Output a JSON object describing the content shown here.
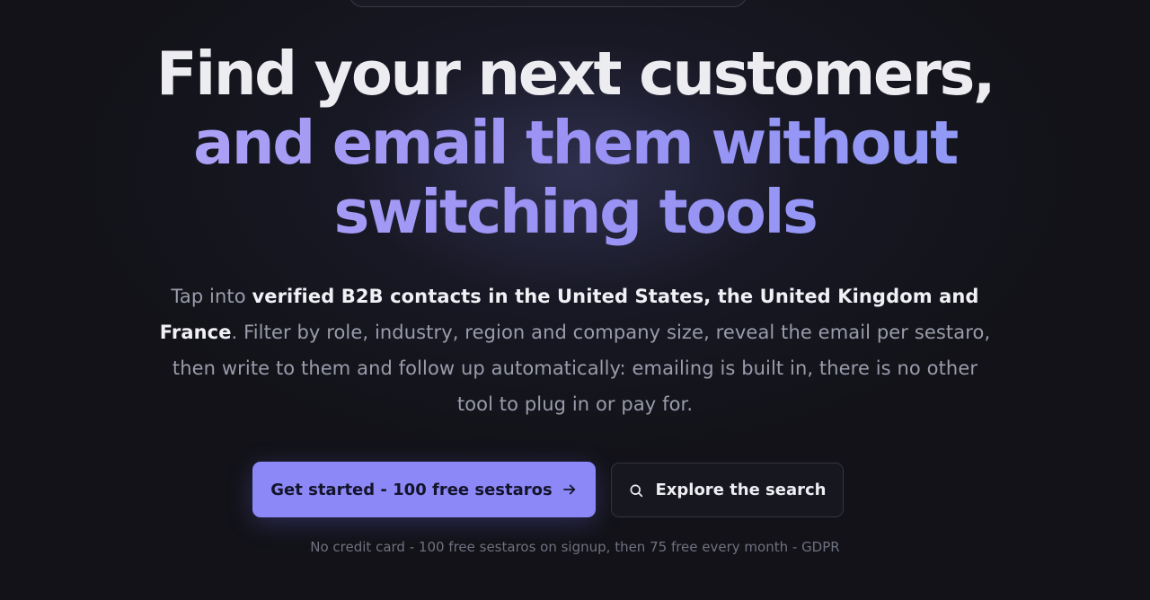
{
  "hero": {
    "headline_line1": "Find your next customers,",
    "headline_line2": "and email them without switching tools",
    "subtext": {
      "part1": "Tap into ",
      "bold1": "verified B2B contacts in the United States, the United Kingdom and France",
      "part2": ". Filter by role, industry, region and company size, reveal the email per sestaro, then write to them and follow up automatically: emailing is built in, there is no other tool to plug in or pay for."
    }
  },
  "actions": {
    "primary_label": "Get started - 100 free sestaros",
    "primary_icon": "arrow-right-icon",
    "secondary_label": "Explore the search",
    "secondary_icon": "search-icon"
  },
  "footnote": "No credit card - 100 free sestaros on signup, then 75 free every month - GDPR",
  "colors": {
    "background": "#121218",
    "accent": "#8c88f7",
    "headline_white": "#ececf1",
    "headline_purple": "#9a92f4"
  }
}
